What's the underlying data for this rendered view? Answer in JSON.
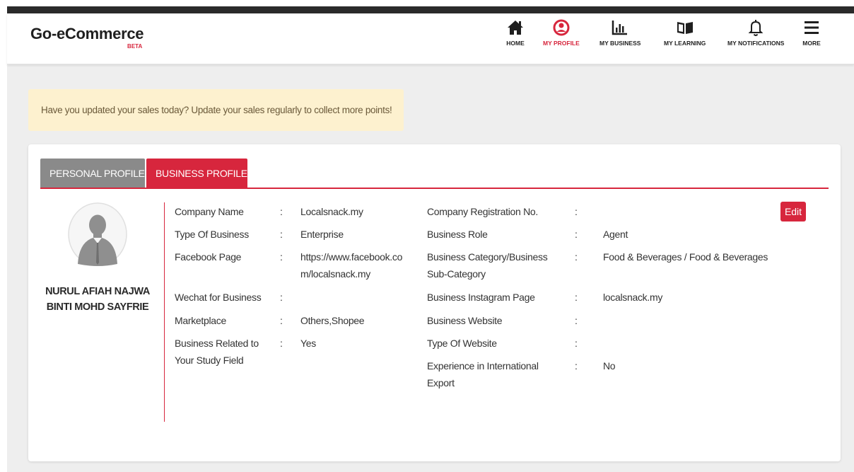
{
  "app": {
    "logo": "Go-eCommerce",
    "beta": "BETA"
  },
  "nav": [
    {
      "label": "HOME",
      "icon": "home-icon"
    },
    {
      "label": "MY PROFILE",
      "icon": "user-icon",
      "active": true
    },
    {
      "label": "MY BUSINESS",
      "icon": "bar-chart-icon"
    },
    {
      "label": "MY LEARNING",
      "icon": "book-icon"
    },
    {
      "label": "MY NOTIFICATIONS",
      "icon": "bell-icon"
    },
    {
      "label": "MORE",
      "icon": "menu-icon"
    }
  ],
  "notice": "Have you updated your sales today? Update your sales regularly to collect more points!",
  "tabs": {
    "personal": "PERSONAL PROFILE",
    "business": "BUSINESS PROFILE"
  },
  "profile": {
    "name_line1": "NURUL AFIAH NAJWA",
    "name_line2": "BINTI MOHD SAYFRIE"
  },
  "edit_label": "Edit",
  "colon": ":",
  "left_fields": [
    {
      "label": "Company Name",
      "value": "Localsnack.my"
    },
    {
      "label": "Type Of Business",
      "value": "Enterprise"
    },
    {
      "label": "Facebook Page",
      "value_line1": "https://www.facebook.co",
      "value_line2": "m/localsnack.my"
    },
    {
      "label": "Wechat for Business",
      "value": ""
    },
    {
      "label": "Marketplace",
      "value": "Others,Shopee"
    },
    {
      "label_line1": "Business Related to",
      "label_line2": "Your Study Field",
      "value": "Yes"
    }
  ],
  "right_fields": [
    {
      "label": "Company Registration No.",
      "value": ""
    },
    {
      "label": "Business Role",
      "value": "Agent"
    },
    {
      "label_line1": "Business Category/Business",
      "label_line2": "Sub-Category",
      "value": "Food & Beverages / Food & Beverages"
    },
    {
      "label": "Business Instagram Page",
      "value": "localsnack.my"
    },
    {
      "label": "Business Website",
      "value": ""
    },
    {
      "label": "Type Of Website",
      "value": ""
    },
    {
      "label_line1": "Experience in International",
      "label_line2": "Export",
      "value": "No"
    }
  ],
  "colors": {
    "accent": "#d7263d",
    "tab_inactive": "#8a8a8a",
    "notice_bg": "#fdf1cf",
    "page_bg": "#eeeeee"
  }
}
